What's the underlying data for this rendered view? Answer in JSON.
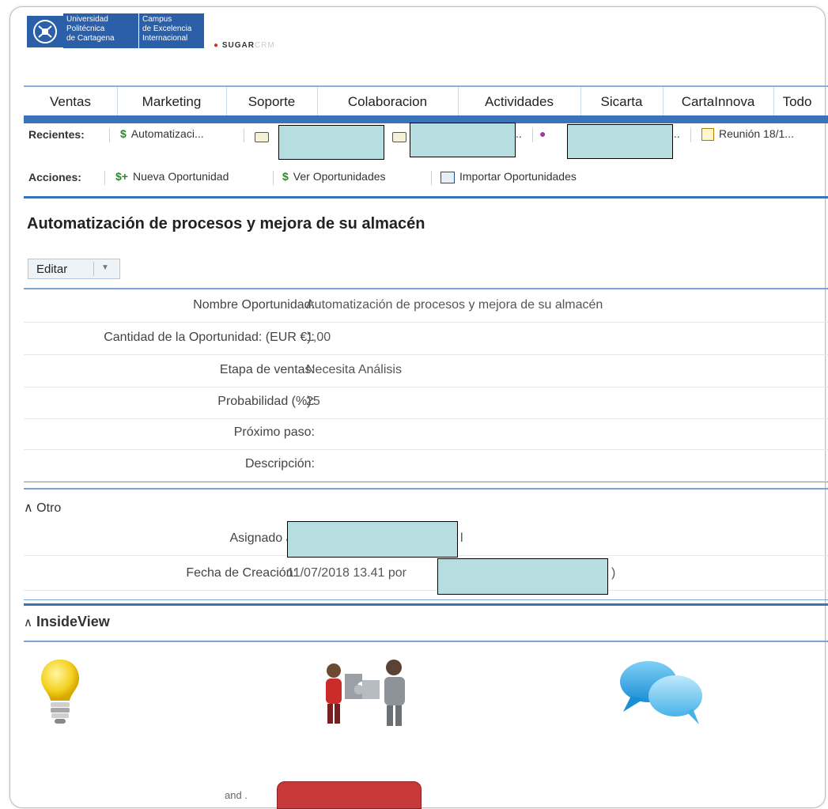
{
  "header": {
    "upct_lines": [
      "Universidad",
      "Politécnica",
      "de Cartagena"
    ],
    "campus_lines": [
      "Campus",
      "de Excelencia",
      "Internacional"
    ],
    "sugar_brand": "SUGAR",
    "sugar_suffix": "CRM"
  },
  "nav": {
    "items": [
      "Ventas",
      "Marketing",
      "Soporte",
      "Colaboracion",
      "Actividades",
      "Sicarta",
      "CartaInnova",
      "Todo"
    ]
  },
  "recientes": {
    "label": "Recientes:",
    "item1": "Automatizaci...",
    "item3_suffix": "..",
    "item4_suffix": "..",
    "item5": "Reunión 18/1..."
  },
  "acciones": {
    "label": "Acciones:",
    "items": [
      "Nueva Oportunidad",
      "Ver Oportunidades",
      "Importar Oportunidades"
    ]
  },
  "record": {
    "title": "Automatización de procesos y mejora de su almacén",
    "edit_label": "Editar"
  },
  "fields": [
    {
      "label": "Nombre Oportunidad:",
      "value": "Automatización de procesos y mejora de su almacén"
    },
    {
      "label": "Cantidad de la Oportunidad: (EUR €):",
      "value": "1,00"
    },
    {
      "label": "Etapa de ventas:",
      "value": "Necesita Análisis"
    },
    {
      "label": "Probabilidad (%):",
      "value": "25"
    },
    {
      "label": "Próximo paso:",
      "value": ""
    },
    {
      "label": "Descripción:",
      "value": ""
    }
  ],
  "otro": {
    "heading": "Otro",
    "assigned_label": "Asignado a:",
    "assigned_tail": "l",
    "created_label": "Fecha de Creación:",
    "created_value": "11/07/2018 13.41 por",
    "created_tail": ")"
  },
  "insideview": {
    "heading": "InsideView",
    "and_text": "and ."
  },
  "colors": {
    "accent_blue": "#3a73b8",
    "redaction": "#b6dde0",
    "cta_red": "#c83a3a"
  }
}
